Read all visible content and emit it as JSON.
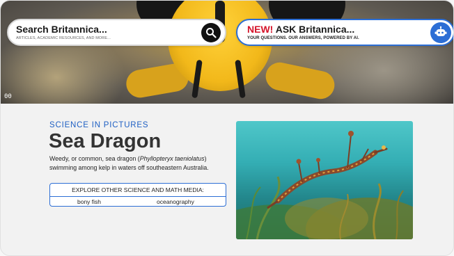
{
  "search": {
    "title": "Search Britannica...",
    "subtitle": "ARTICLES, ACADEMIC RESOURCES, AND MORE..."
  },
  "ask": {
    "new_label": "NEW!",
    "title": "ASK Britannica...",
    "subtitle": "YOUR QUESTIONS. OUR ANSWERS, POWERED BY AI."
  },
  "hero": {
    "badge": "00"
  },
  "article": {
    "eyebrow": "SCIENCE IN PICTURES",
    "title": "Sea Dragon",
    "description_before": "Weedy, or common, sea dragon (",
    "description_italic": "Phyllopteryx taeniolatus",
    "description_after": ") swimming among kelp in waters off southeastern Australia."
  },
  "explore": {
    "heading": "EXPLORE OTHER SCIENCE AND MATH MEDIA:",
    "links": [
      "bony fish",
      "oceanography"
    ]
  },
  "icons": {
    "search": "search-icon",
    "ai": "robot-icon"
  },
  "colors": {
    "accent_blue": "#2c6ed5",
    "new_red": "#d5142a",
    "eyebrow_blue": "#1e5fc3"
  }
}
